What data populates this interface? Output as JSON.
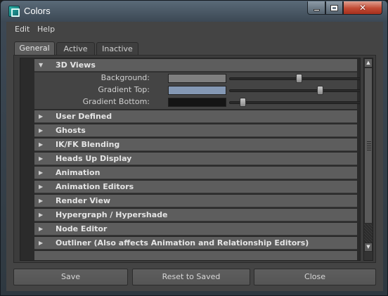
{
  "window": {
    "title": "Colors"
  },
  "menubar": {
    "items": [
      {
        "label": "Edit"
      },
      {
        "label": "Help"
      }
    ]
  },
  "tabs": [
    {
      "label": "General",
      "selected": true
    },
    {
      "label": "Active",
      "selected": false
    },
    {
      "label": "Inactive",
      "selected": false
    }
  ],
  "sections": [
    {
      "label": "3D Views",
      "expanded": true,
      "attributes": [
        {
          "label": "Background:",
          "color": "#7f7f7f",
          "slider_fraction": 0.5
        },
        {
          "label": "Gradient Top:",
          "color": "#8498b4",
          "slider_fraction": 0.66
        },
        {
          "label": "Gradient Bottom:",
          "color": "#151515",
          "slider_fraction": 0.08
        }
      ]
    },
    {
      "label": "User Defined",
      "expanded": false
    },
    {
      "label": "Ghosts",
      "expanded": false
    },
    {
      "label": "IK/FK Blending",
      "expanded": false
    },
    {
      "label": "Heads Up Display",
      "expanded": false
    },
    {
      "label": "Animation",
      "expanded": false
    },
    {
      "label": "Animation Editors",
      "expanded": false
    },
    {
      "label": "Render View",
      "expanded": false
    },
    {
      "label": "Hypergraph / Hypershade",
      "expanded": false
    },
    {
      "label": "Node Editor",
      "expanded": false
    },
    {
      "label": "Outliner (Also affects Animation and Relationship Editors)",
      "expanded": false
    }
  ],
  "buttons": {
    "save": "Save",
    "reset": "Reset to Saved",
    "close": "Close"
  },
  "icons": {
    "expanded_arrow": "triangle-down",
    "collapsed_arrow": "triangle-right",
    "app": "maya-icon"
  },
  "colors": {
    "panel_bg": "#444444",
    "section_header": "#5d5d5d",
    "close_button": "#c24a33"
  }
}
